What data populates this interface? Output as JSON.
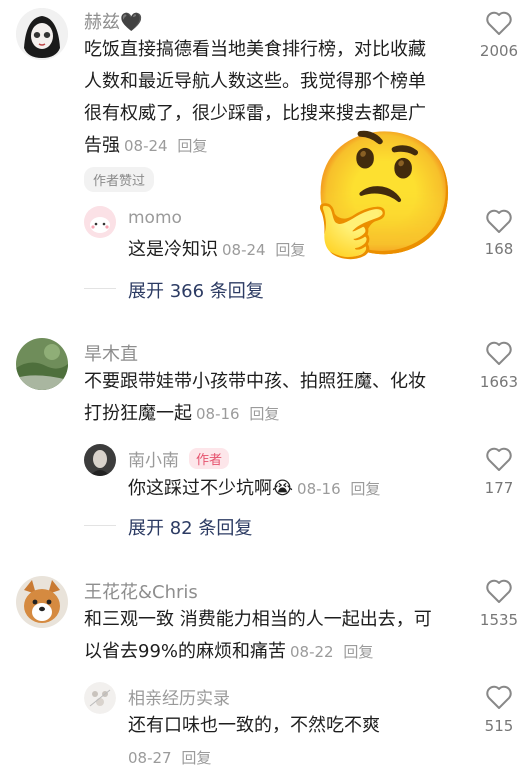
{
  "comments": [
    {
      "username": "赫兹🖤",
      "text_lines": [
        "吃饭直接搞德看当地美食排行榜，对比收藏",
        "人数和最近导航人数这些。我觉得那个榜单",
        "很有权威了，很少踩雷，比搜来搜去都是广"
      ],
      "last_line": "告强",
      "date": "08-24",
      "reply_label": "回复",
      "likes": "2006",
      "badge": "作者赞过",
      "reply": {
        "username": "momo",
        "text": "这是冷知识",
        "date": "08-24",
        "reply_label": "回复",
        "likes": "168"
      },
      "expand": "展开 366 条回复"
    },
    {
      "username": "旱木直",
      "text_lines": [
        "不要跟带娃带小孩带中孩、拍照狂魔、化妆"
      ],
      "last_line": "打扮狂魔一起",
      "date": "08-16",
      "reply_label": "回复",
      "likes": "1663",
      "reply": {
        "username": "南小南",
        "author_tag": "作者",
        "text": "你这踩过不少坑啊",
        "emoji": "😭",
        "date": "08-16",
        "reply_label": "回复",
        "likes": "177"
      },
      "expand": "展开 82 条回复"
    },
    {
      "username": "王花花&Chris",
      "text_lines": [
        "和三观一致 消费能力相当的人一起出去，可"
      ],
      "last_line": "以省去99%的麻烦和痛苦",
      "date": "08-22",
      "reply_label": "回复",
      "likes": "1535",
      "reply": {
        "username": "相亲经历实录",
        "text": "还有口味也一致的，不然吃不爽",
        "date": "08-27",
        "reply_label": "回复",
        "likes": "515"
      }
    }
  ],
  "sticker": "🤔",
  "icons": {
    "like": "heart-outline-icon"
  },
  "colors": {
    "expand": "#2c3b63",
    "author_tag": "#e5536e"
  }
}
